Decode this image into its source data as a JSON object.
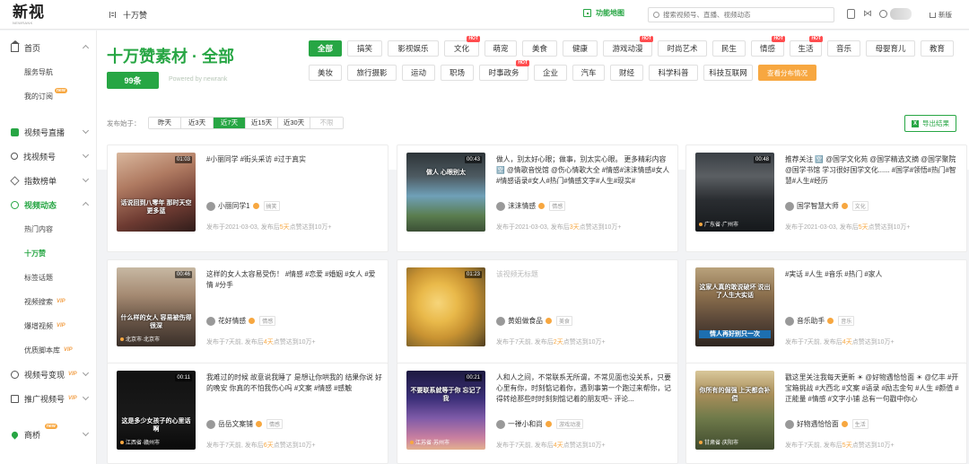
{
  "topbar": {
    "logo": "新视",
    "logo_sub": "NEWRANK",
    "breadcrumb": "十万赞",
    "feature_label": "功能地图",
    "search_placeholder": "搜索视频号、直播、视频动态",
    "new_version": "新版"
  },
  "sidebar": {
    "home": "首页",
    "sub_home": [
      "服务导航",
      "我的订阅"
    ],
    "live": "视频号直播",
    "find": "找视频号",
    "rank": "指数榜单",
    "dynamics": "视频动态",
    "dyn_subs": [
      "热门内容",
      "十万赞",
      "标签话题",
      "视频搜索",
      "爆增视频",
      "优质脚本库"
    ],
    "monetize": "视频号变现",
    "promote": "推广视频号",
    "bridge": "商桥",
    "vip": "VIP",
    "new_tag": "new"
  },
  "header": {
    "title": "十万赞素材 · 全部",
    "count": "99条",
    "powered": "Powered by newrank",
    "categories_row1": [
      {
        "label": "全部",
        "active": true
      },
      {
        "label": "搞笑"
      },
      {
        "label": "影视娱乐"
      },
      {
        "label": "文化",
        "hot": true
      },
      {
        "label": "萌宠"
      },
      {
        "label": "美食"
      },
      {
        "label": "健康"
      },
      {
        "label": "游戏动漫",
        "hot": true
      },
      {
        "label": "时尚艺术"
      },
      {
        "label": "民生"
      },
      {
        "label": "情感",
        "hot": true
      },
      {
        "label": "生活",
        "hot": true
      },
      {
        "label": "音乐"
      },
      {
        "label": "母婴育儿"
      },
      {
        "label": "教育"
      }
    ],
    "categories_row2": [
      {
        "label": "美妆"
      },
      {
        "label": "旅行摄影"
      },
      {
        "label": "运动"
      },
      {
        "label": "职场"
      },
      {
        "label": "时事政务",
        "hot": true
      },
      {
        "label": "企业"
      },
      {
        "label": "汽车"
      },
      {
        "label": "财经"
      },
      {
        "label": "科学科普"
      },
      {
        "label": "科技互联网"
      },
      {
        "label": "查看分布情况",
        "special": true
      }
    ],
    "hot_label": "HOT",
    "date_label": "发布始于：",
    "date_options": [
      "昨天",
      "近3天",
      "近7天",
      "近15天",
      "近30天",
      "不限"
    ],
    "date_active": 2,
    "export": "导出结果"
  },
  "cards": [
    {
      "text": "#小丽同学 #街头采访 #过于真实",
      "author": "小丽同学1",
      "tag": "搞笑",
      "duration": "01:03",
      "overlay": "话说回到八零年\n那时天空更多蓝",
      "location": "",
      "pub_prefix": "发布于2021-03-03, 发布后",
      "pub_days": "5天",
      "pub_suffix": "点赞达到10万+",
      "bg": "linear-gradient(160deg,#d9b79d 0%,#b07b62 35%,#6e3b32 70%,#2f1c1a 100%)"
    },
    {
      "text": "做人，别太好心眼；做事，别太实心眼。 更多精彩内容 🈳 @情歌音悦馆 @伤心情歌大全 #情感#沫沫情感#女人#情感语录#女人#热门#情感文字#人生#现实#",
      "author": "沫沫情感",
      "tag": "情感",
      "duration": "00:43",
      "overlay": "做人\n心眼别太",
      "location": "",
      "pub_prefix": "发布于2021-03-03, 发布后",
      "pub_days": "3天",
      "pub_suffix": "点赞达到10万+",
      "bg": "linear-gradient(180deg,#2d3438 0%,#4d5a61 30%,#6fa0b8 55%,#5a7d4f 80%,#3b4f35 100%)"
    },
    {
      "text": "推荐关注 🈳 @国学文化苑 @国学精选文摘 @国学聚院 @国学书馆 学习很好国学文化...... #国学#领悟#热门#智慧#人生#经历",
      "author": "国学智慧大师",
      "tag": "文化",
      "duration": "00:48",
      "overlay": "",
      "location": "广东省·广州市",
      "pub_prefix": "发布于2021-03-03, 发布后",
      "pub_days": "5天",
      "pub_suffix": "点赞达到10万+",
      "bg": "linear-gradient(180deg,#3a3f45 0%,#5b5f63 30%,#2a2d31 60%,#15181b 100%)"
    },
    {
      "text": "这样的女人太容易受伤！ #情感 #恋爱 #婚姻 #女人 #爱情 #分手",
      "author": "花好情感",
      "tag": "情感",
      "duration": "00:46",
      "overlay": "什么样的女人\n容易被伤得很深",
      "location": "北京市·北京市",
      "pub_prefix": "发布于7天前, 发布后",
      "pub_days": "4天",
      "pub_suffix": "点赞达到10万+",
      "bg": "linear-gradient(180deg,#c7b8a3 0%,#a58a72 35%,#6b5748 65%,#3a302a 100%)"
    },
    {
      "text": "该视频无标题",
      "muted": true,
      "author": "黄姐做食品",
      "tag": "美食",
      "duration": "01:23",
      "overlay": "",
      "location": "",
      "pub_prefix": "发布于7天前, 发布后",
      "pub_days": "2天",
      "pub_suffix": "点赞达到10万+",
      "bg": "radial-gradient(circle at 40% 45%,#f6d57a 0%,#e9b94a 30%,#c99332 55%,#8a6a2b 80%,#4e3c1e 100%)"
    },
    {
      "text": "#実话 #人生 #音乐 #热门 #家人",
      "author": "音乐助手",
      "tag": "音乐",
      "duration": "",
      "overlay": "这家人真的敢说破坏\n说出了人生大实话",
      "location": "",
      "banner": "情人再好别只一次",
      "pub_prefix": "发布于7天前, 发布后",
      "pub_days": "4天",
      "pub_suffix": "点赞达到10万+",
      "bg": "linear-gradient(180deg,#b9a27c 0%,#8b6f4d 35%,#5e4a3a 65%,#2d2520 100%)"
    },
    {
      "text": "我难过的时候 故意说我睡了 是想让你哄我的 结果你说 好的晚安 你真的不怕我伤心吗 #文案 #情感 #感触",
      "author": "岳岳文案铺",
      "tag": "情感",
      "duration": "00:11",
      "overlay": "这是多少女孩子的心里话啊",
      "location": "江西省·赣州市",
      "pub_prefix": "发布于7天前, 发布后",
      "pub_days": "6天",
      "pub_suffix": "点赞达到10万+",
      "bg": "linear-gradient(180deg,#111 0%,#1a1a1a 60%,#0a0a0a 100%)"
    },
    {
      "text": "人和人之间，不常联系无所谓，不常见面也没关系，只要心里有你，时刻惦记着你，遇到事第一个跑过来帮你，记得转给那些时时刻刻惦记着的朋友吧~ 评论...",
      "author": "一禅小和尚",
      "tag": "游戏动漫",
      "duration": "00:21",
      "overlay": "不要联系就等于你\n忘记了我",
      "location": "江苏省·苏州市",
      "pub_prefix": "发布于7天前, 发布后",
      "pub_days": "4天",
      "pub_suffix": "点赞达到10万+",
      "bg": "linear-gradient(180deg,#1c1a40 0%,#3b2f78 35%,#7e5aa8 60%,#c97fa0 85%,#e3b08f 100%)"
    },
    {
      "text": "戳这里关注我每天更新 ☀ @好物遇恰恰面 ☀ @亿丰 #开宝箱挑战 #大西北 #文案 #语录 #励志金句 #人生 #颜值 #正能量 #情感 #文字小铺 总有一句戳中你心",
      "author": "好物遇恰恰面",
      "tag": "生活",
      "duration": "",
      "overlay": "你所有的倔强\n上天都会补偿",
      "location": "甘肃省·庆阳市",
      "pub_prefix": "发布于7天前, 发布后",
      "pub_days": "5天",
      "pub_suffix": "点赞达到10万+",
      "bg": "linear-gradient(180deg,#d9c79a 0%,#a88e5a 30%,#6f7a4a 60%,#3f4a2e 100%)"
    }
  ]
}
